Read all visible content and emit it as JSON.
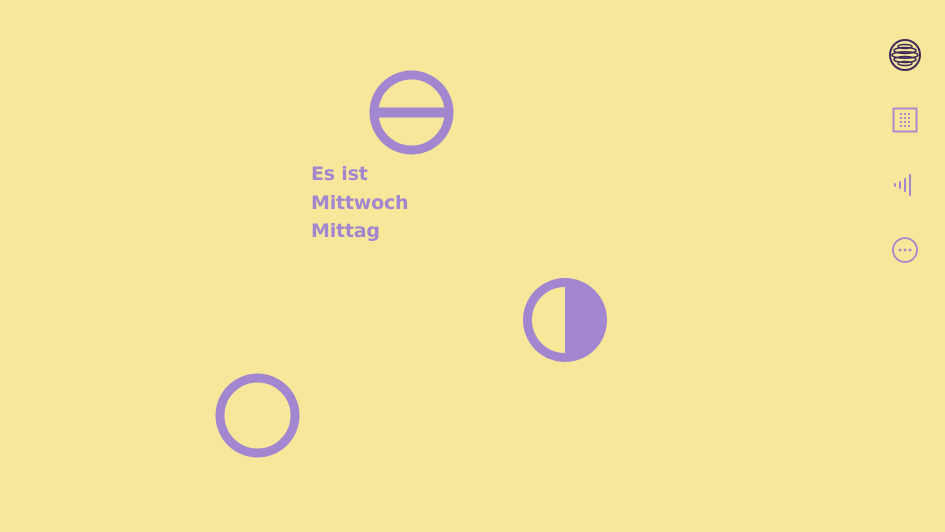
{
  "colors": {
    "background": "#f7e79a",
    "accent": "#a286d0",
    "active_icon": "#3e2a5c"
  },
  "status": {
    "line1": "Es ist",
    "line2": "Mittwoch",
    "line3": "Mittag"
  },
  "symbols": [
    {
      "name": "circle-horizontal-bar-icon"
    },
    {
      "name": "half-filled-circle-icon"
    },
    {
      "name": "ring-icon"
    }
  ],
  "nav": [
    {
      "icon": "globe-lines-icon",
      "active": true
    },
    {
      "icon": "grid-square-icon",
      "active": false
    },
    {
      "icon": "sound-bars-icon",
      "active": false
    },
    {
      "icon": "more-options-icon",
      "active": false
    }
  ]
}
